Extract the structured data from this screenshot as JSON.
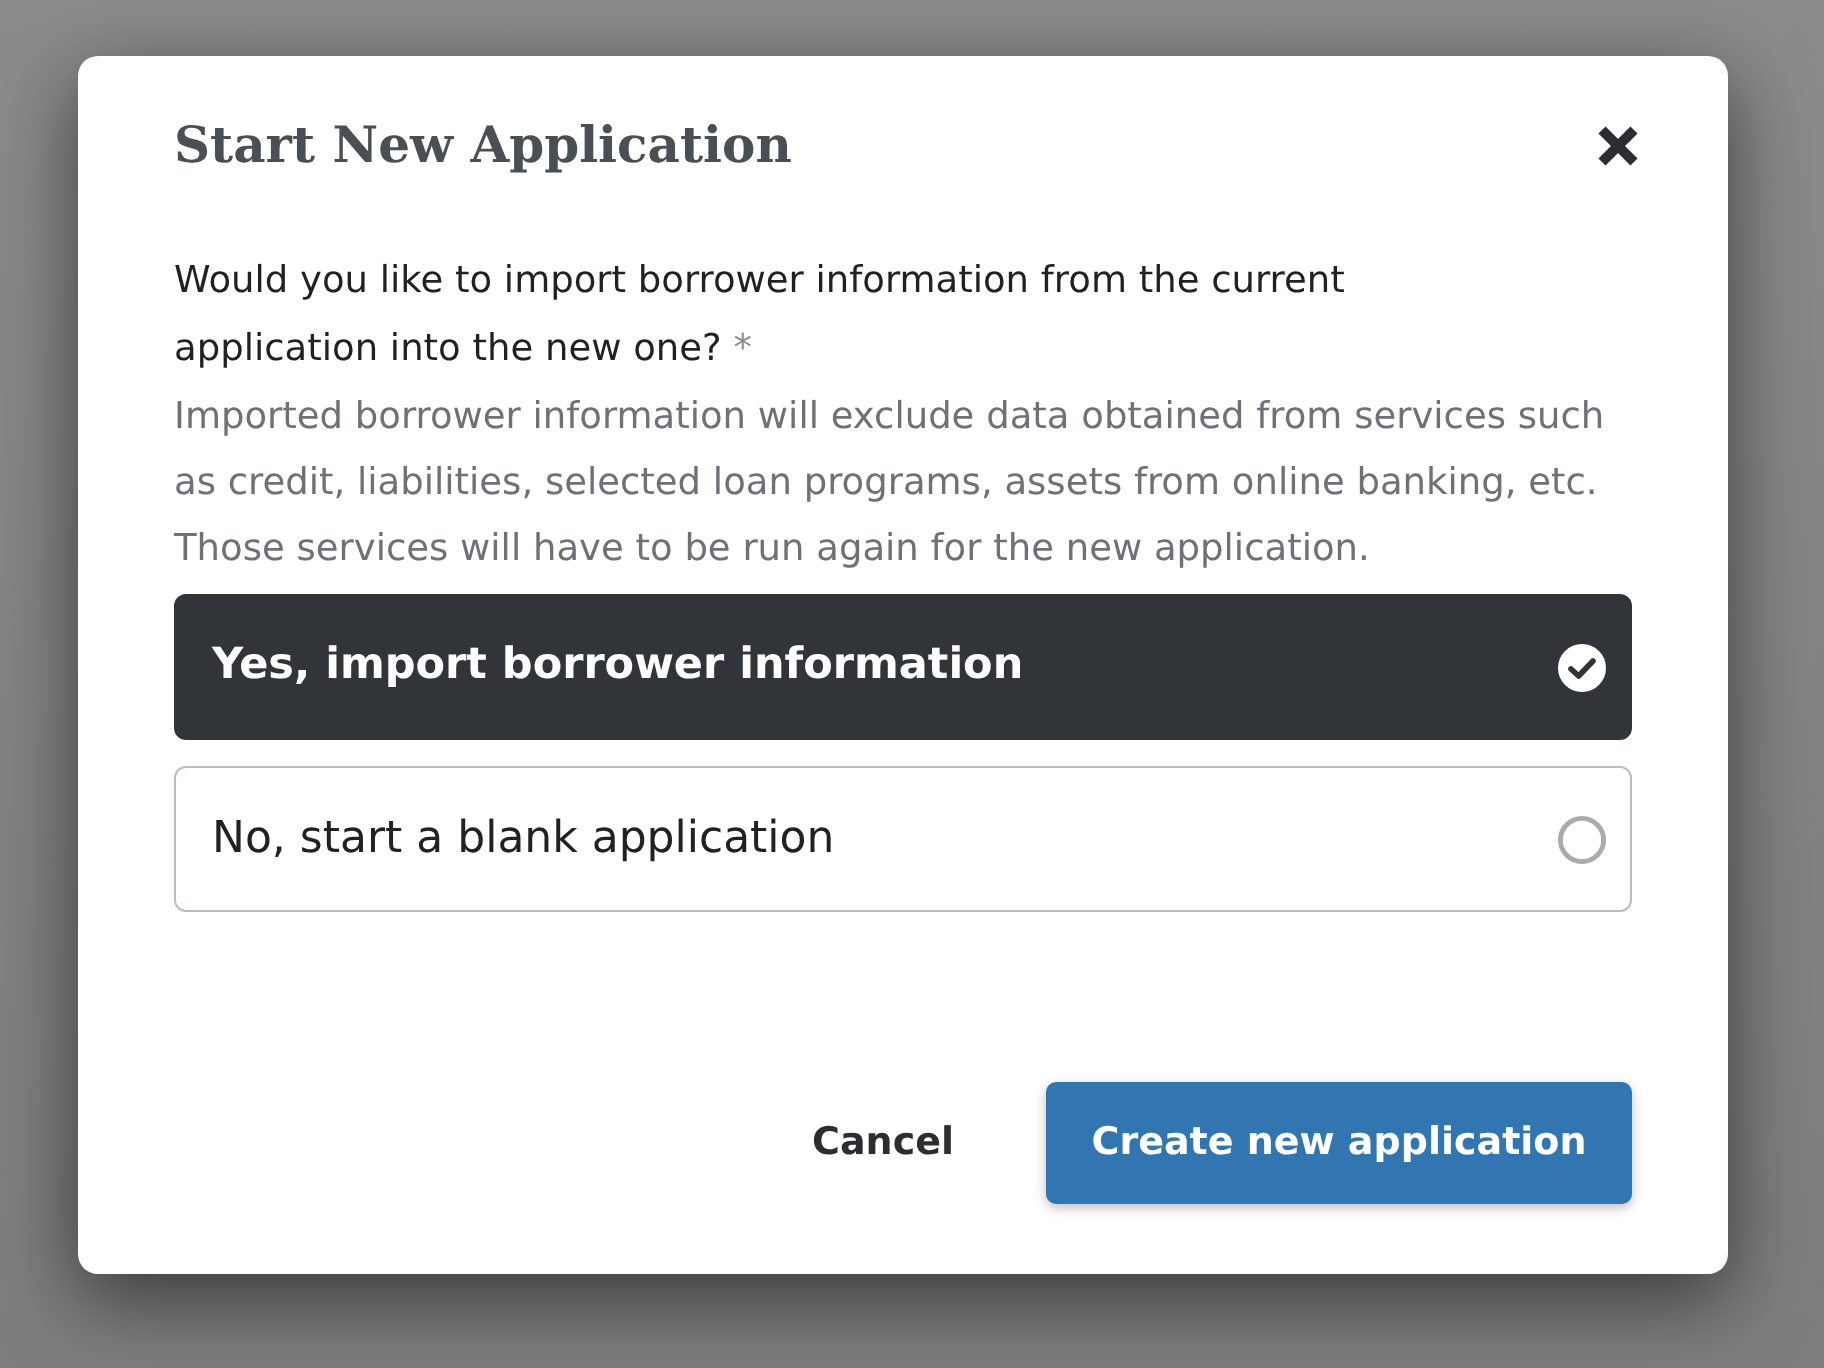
{
  "dialog": {
    "title": "Start New Application"
  },
  "question": {
    "text": "Would you like to import borrower information from the current application into the new one?",
    "required_mark": "*"
  },
  "description": "Imported borrower information will exclude data obtained from services such as credit, liabilities, selected loan programs, assets from online banking, etc. Those services will have to be run again for the new application.",
  "options": [
    {
      "label": "Yes, import borrower information",
      "selected": true
    },
    {
      "label": "No, start a blank application",
      "selected": false
    }
  ],
  "buttons": [
    {
      "label": "Cancel",
      "kind": "secondary"
    },
    {
      "label": "Create new application",
      "kind": "primary"
    }
  ]
}
